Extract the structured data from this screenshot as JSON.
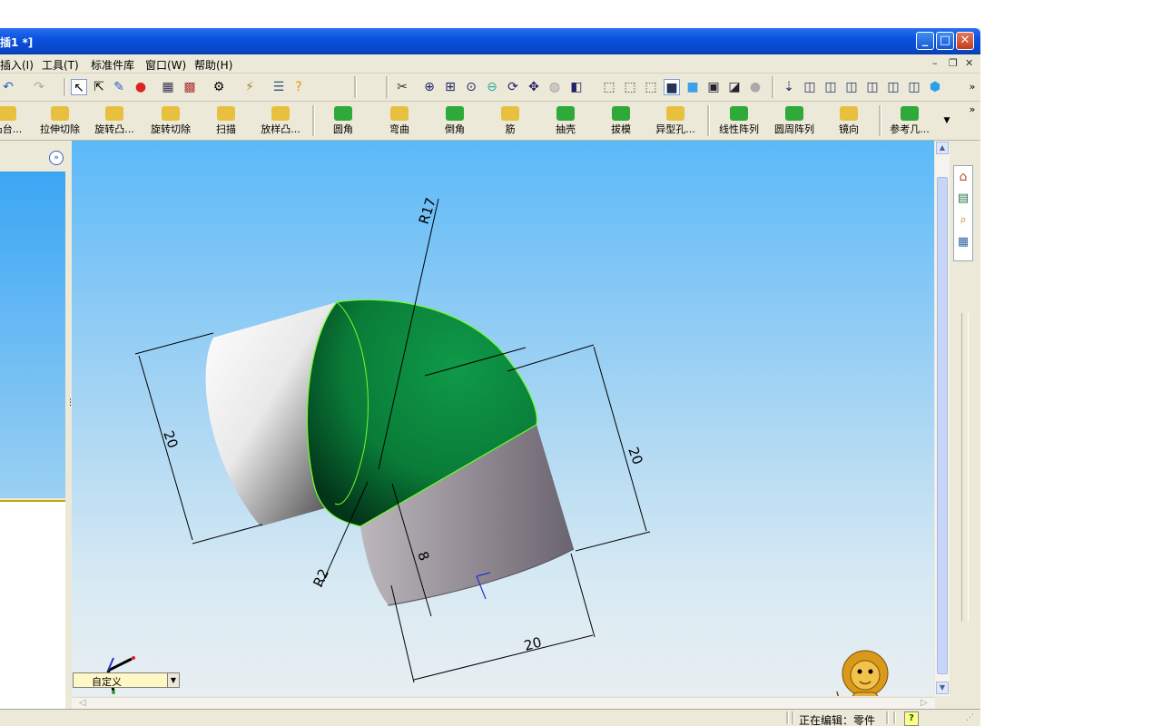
{
  "window": {
    "title": "插1 *]"
  },
  "menu": {
    "items": [
      "插入(I)",
      "工具(T)",
      "标准件库",
      "窗口(W)",
      "帮助(H)"
    ]
  },
  "features": [
    {
      "label": "凸台...",
      "icon": "boss-extrude-icon",
      "color": "#e8c040"
    },
    {
      "label": "拉伸切除",
      "icon": "extruded-cut-icon",
      "color": "#e8c040"
    },
    {
      "label": "旋转凸...",
      "icon": "revolved-boss-icon",
      "color": "#e8c040"
    },
    {
      "label": "旋转切除",
      "icon": "revolved-cut-icon",
      "color": "#e8c040"
    },
    {
      "label": "扫描",
      "icon": "sweep-icon",
      "color": "#e8c040"
    },
    {
      "label": "放样凸...",
      "icon": "loft-icon",
      "color": "#e8c040"
    },
    {
      "label": "圆角",
      "icon": "fillet-icon",
      "color": "#2faa3a"
    },
    {
      "label": "弯曲",
      "icon": "flex-icon",
      "color": "#e8c040"
    },
    {
      "label": "倒角",
      "icon": "chamfer-icon",
      "color": "#2faa3a"
    },
    {
      "label": "筋",
      "icon": "rib-icon",
      "color": "#e8c040"
    },
    {
      "label": "抽壳",
      "icon": "shell-icon",
      "color": "#2faa3a"
    },
    {
      "label": "拔模",
      "icon": "draft-icon",
      "color": "#2faa3a"
    },
    {
      "label": "异型孔...",
      "icon": "hole-wizard-icon",
      "color": "#e8c040"
    },
    {
      "label": "线性阵列",
      "icon": "linear-pattern-icon",
      "color": "#2faa3a"
    },
    {
      "label": "圆周阵列",
      "icon": "circular-pattern-icon",
      "color": "#2faa3a"
    },
    {
      "label": "镜向",
      "icon": "mirror-icon",
      "color": "#e8c040"
    },
    {
      "label": "参考几...",
      "icon": "reference-geometry-icon",
      "color": "#2faa3a"
    }
  ],
  "dimensions": {
    "r17": "R17",
    "r2": "R2",
    "left20": "20",
    "right20": "20",
    "bottom20": "20",
    "eight": "8"
  },
  "view": {
    "orientation": "自定义"
  },
  "status": {
    "editing": "正在编辑：零件",
    "help": "?"
  },
  "colors": {
    "title_bar": "#0a52e0",
    "green_face": "#0b8a3e",
    "edge_highlight": "#7cff3a"
  }
}
